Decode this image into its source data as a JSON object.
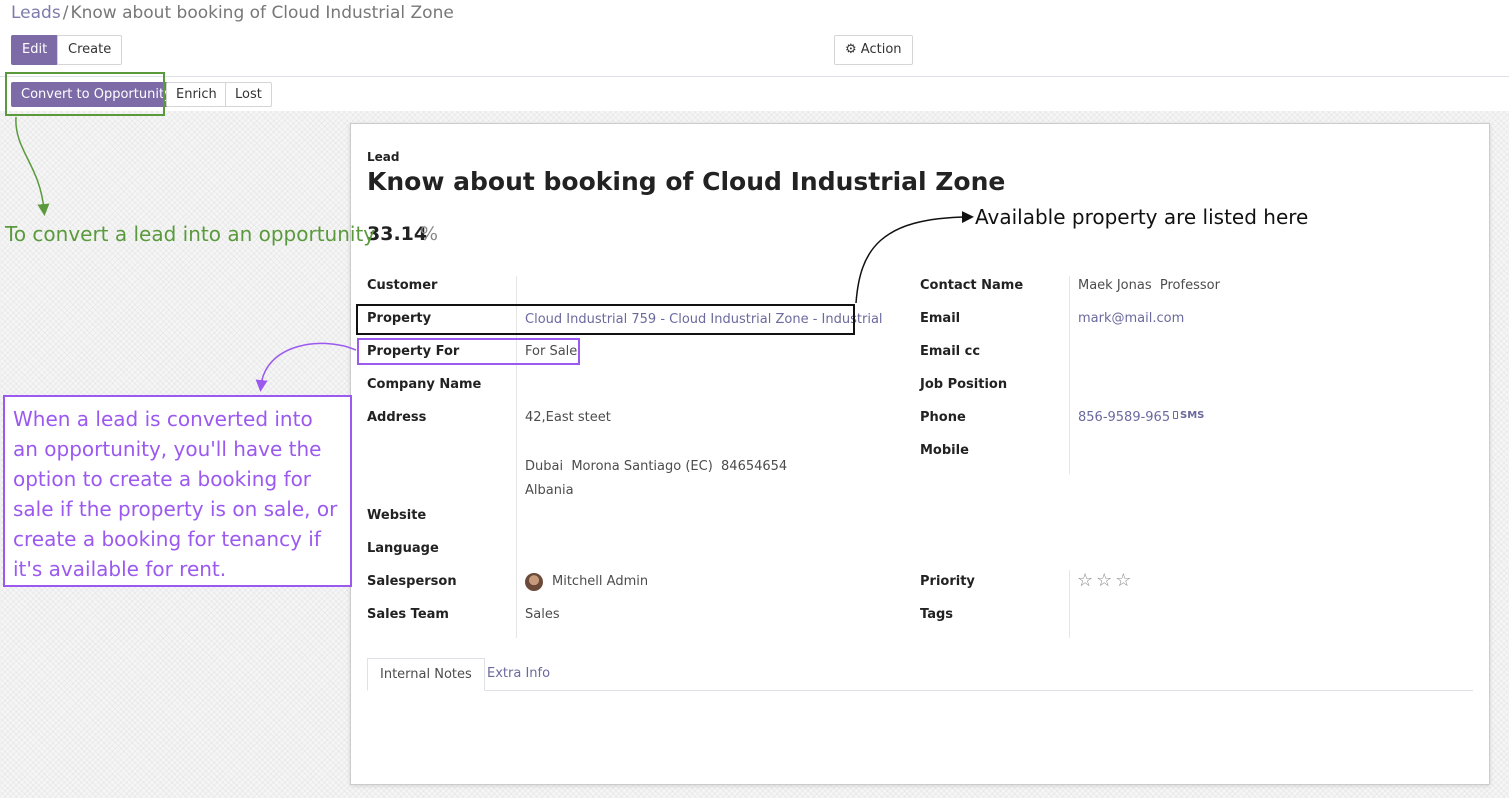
{
  "breadcrumb": {
    "parent": "Leads",
    "separator": "/",
    "current": "Know about booking of Cloud Industrial Zone"
  },
  "toolbar": {
    "edit_label": "Edit",
    "create_label": "Create",
    "action_label": "Action"
  },
  "statusbar": {
    "convert_label": "Convert to Opportunity",
    "enrich_label": "Enrich",
    "lost_label": "Lost"
  },
  "record": {
    "type_label": "Lead",
    "title": "Know about booking of Cloud Industrial Zone",
    "probability": "33.14",
    "probability_unit": "%"
  },
  "left_fields": {
    "customer": {
      "label": "Customer",
      "value": ""
    },
    "property": {
      "label": "Property",
      "value": "Cloud Industrial 759 - Cloud Industrial Zone - Industrial"
    },
    "property_for": {
      "label": "Property For",
      "value": "For Sale"
    },
    "company_name": {
      "label": "Company Name",
      "value": ""
    },
    "address": {
      "label": "Address",
      "street": "42,East steet",
      "city_line": "Dubai  Morona Santiago (EC)  84654654",
      "country": "Albania"
    },
    "website": {
      "label": "Website",
      "value": ""
    },
    "language": {
      "label": "Language",
      "value": ""
    },
    "salesperson": {
      "label": "Salesperson",
      "value": "Mitchell Admin"
    },
    "sales_team": {
      "label": "Sales Team",
      "value": "Sales"
    }
  },
  "right_fields": {
    "contact_name": {
      "label": "Contact Name",
      "value": "Maek Jonas  Professor"
    },
    "email": {
      "label": "Email",
      "value": "mark@mail.com"
    },
    "email_cc": {
      "label": "Email cc",
      "value": ""
    },
    "job_position": {
      "label": "Job Position",
      "value": ""
    },
    "phone": {
      "label": "Phone",
      "value": "856-9589-965",
      "sms_label": "SMS"
    },
    "mobile": {
      "label": "Mobile",
      "value": ""
    },
    "priority": {
      "label": "Priority",
      "stars": "☆☆☆",
      "rating": 0,
      "max": 3
    },
    "tags": {
      "label": "Tags",
      "value": ""
    }
  },
  "tabs": [
    {
      "label": "Internal Notes",
      "active": true
    },
    {
      "label": "Extra Info",
      "active": false
    }
  ],
  "annotations": {
    "green_note": "To convert a lead into an opportunity",
    "black_note": "Available property are listed here",
    "purple_note": "When a lead is converted into an opportunity, you'll have the option to create a booking for sale if the property is on sale, or create a booking for tenancy if it's available for rent.",
    "colors": {
      "green": "#5a9a3c",
      "black": "#111111",
      "purple": "#9b59f0"
    }
  },
  "icons": {
    "action": "gear-icon",
    "sms": "mobile-phone-icon",
    "priority": "star-outline-icon"
  },
  "theme": {
    "primary": "#7c6ba6",
    "link": "#6a6a9e"
  }
}
